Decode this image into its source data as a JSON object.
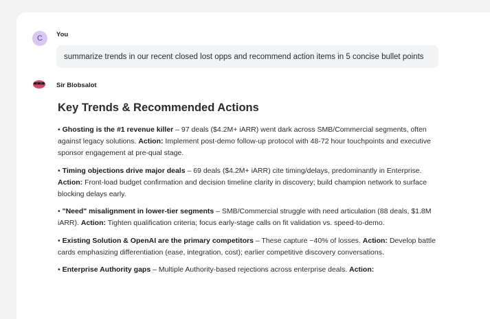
{
  "user": {
    "avatar_initial": "C",
    "name": "You",
    "message": "summarize trends in our recent closed lost opps and recommend action items in 5 concise bullet points"
  },
  "assistant": {
    "name": "Sir Blobsalot",
    "heading": "Key Trends & Recommended Actions",
    "bullets": [
      {
        "marker": "•",
        "title": "Ghosting is the #1 revenue killer",
        "text": " – 97 deals ($4.2M+ iARR) went dark across SMB/Commercial segments, often against legacy solutions. ",
        "action_label": "Action:",
        "action": " Implement post-demo follow-up protocol with 48-72 hour touchpoints and executive sponsor engagement at pre-qual stage."
      },
      {
        "marker": "•",
        "title": "Timing objections drive major deals",
        "text": " – 69 deals ($4.2M+ iARR) cite timing/delays, predominantly in Enterprise. ",
        "action_label": "Action:",
        "action": " Front-load budget confirmation and decision timeline clarity in discovery; build champion network to surface blocking delays early."
      },
      {
        "marker": "•",
        "title": "\"Need\" misalignment in lower-tier segments",
        "text": " – SMB/Commercial struggle with need articulation (88 deals, $1.8M iARR). ",
        "action_label": "Action:",
        "action": " Tighten qualification criteria; focus early-stage calls on fit validation vs. speed-to-demo."
      },
      {
        "marker": "•",
        "title": "Existing Solution & OpenAI are the primary competitors",
        "text": " – These capture ~40% of losses. ",
        "action_label": "Action:",
        "action": " Develop battle cards emphasizing differentiation (ease, integration, cost); earlier competitive discovery conversations."
      },
      {
        "marker": "•",
        "title": "Enterprise Authority gaps",
        "text": " – Multiple Authority-based rejections across enterprise deals. ",
        "action_label": "Action:",
        "action": ""
      }
    ]
  },
  "colors": {
    "user_avatar_bg": "#d9c7f4",
    "bubble_bg": "#f2f3f5",
    "page_bg": "#f3f3f4"
  }
}
